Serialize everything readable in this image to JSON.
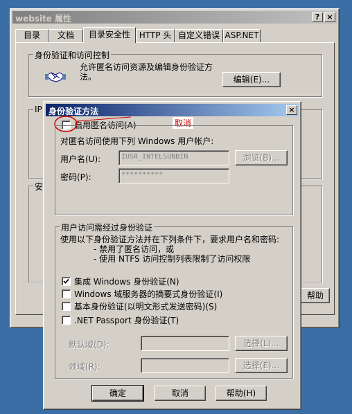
{
  "back_window": {
    "title": "website 属性",
    "help_btn": "?",
    "close_btn": "×",
    "tabs": [
      "目录",
      "文档",
      "目录安全性",
      "HTTP 头",
      "自定义错误",
      "ASP.NET"
    ],
    "group_auth_label": "身份验证和访问控制",
    "auth_description": "允许匿名访问资源及编辑身份验证方法。",
    "edit_button": "编辑(E)...",
    "group_ip_label": "IP",
    "group_secure_label": "安全",
    "help_button_partial": "帮助"
  },
  "dialog": {
    "title": "身份验证方法",
    "close_btn": "×",
    "anon_checkbox_label": "启用匿名访问(A)",
    "anon_checkbox_checked": false,
    "annotation_text": "取消",
    "annotation_color": "#cc0000",
    "anon_account_desc": "对匿名访问使用下列 Windows 用户帐户:",
    "username_label": "用户名(U):",
    "username_value": "IUSR_INTELSUNBIN",
    "browse_button": "浏览(B)...",
    "password_label": "密码(P):",
    "password_value": "**********",
    "auth_group_label": "用户访问需经过身份验证",
    "auth_desc_1": "使用以下身份验证方法并在下列条件下，要求用户名和密码:",
    "auth_desc_2": "- 禁用了匿名访问，或",
    "auth_desc_3": "- 使用 NTFS 访问控制列表限制了访问权限",
    "methods": [
      {
        "label": "集成 Windows 身份验证(N)",
        "checked": true
      },
      {
        "label": "Windows 域服务器的摘要式身份验证(I)",
        "checked": false
      },
      {
        "label": "基本身份验证(以明文形式发送密码)(S)",
        "checked": false
      },
      {
        "label": ".NET Passport 身份验证(T)",
        "checked": false
      }
    ],
    "default_domain_label": "默认域(D):",
    "default_domain_select": "选择(L)...",
    "realm_label": "领域(R):",
    "realm_select": "选择(E)...",
    "ok_button": "确定",
    "cancel_button": "取消",
    "help_button": "帮助(H)"
  }
}
